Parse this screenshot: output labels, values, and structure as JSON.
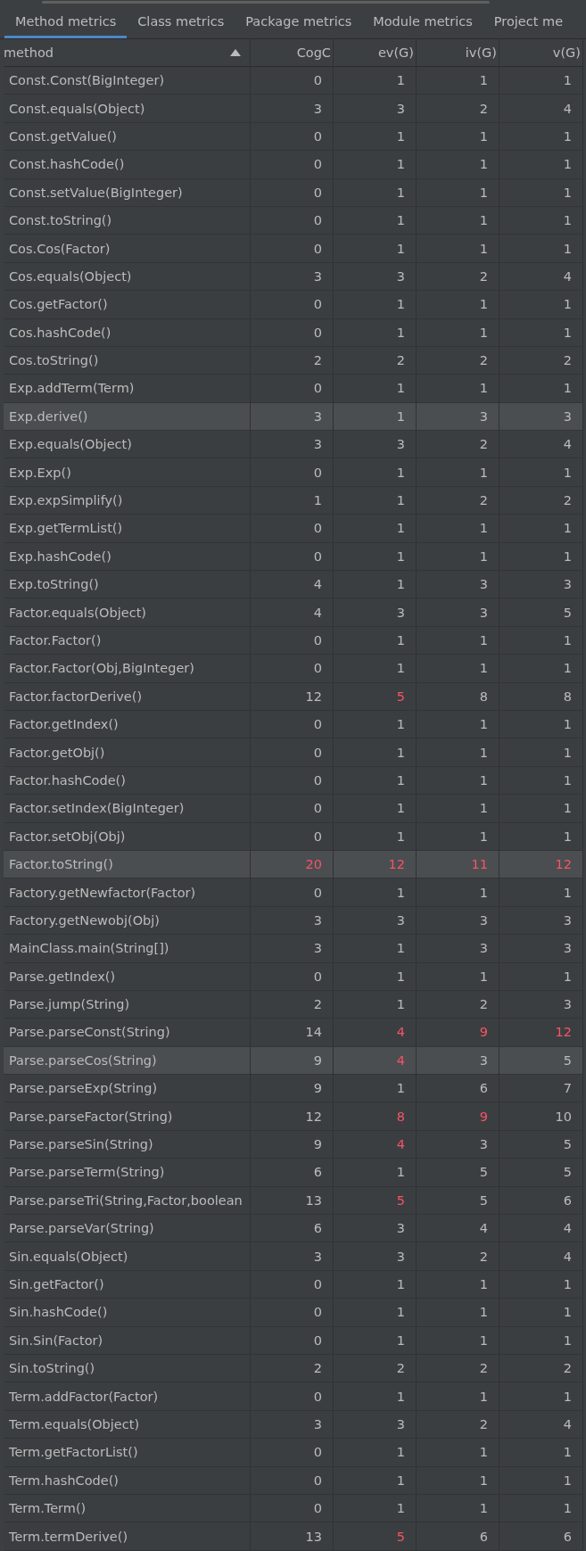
{
  "tabs": [
    {
      "label": "Method metrics",
      "selected": true
    },
    {
      "label": "Class metrics",
      "selected": false
    },
    {
      "label": "Package metrics",
      "selected": false
    },
    {
      "label": "Module metrics",
      "selected": false
    },
    {
      "label": "Project me",
      "selected": false
    }
  ],
  "table": {
    "columns": [
      {
        "label": "method",
        "sorted": true
      },
      {
        "label": "CogC",
        "sorted": false
      },
      {
        "label": "ev(G)",
        "sorted": false
      },
      {
        "label": "iv(G)",
        "sorted": false
      },
      {
        "label": "v(G)",
        "sorted": false
      }
    ],
    "rows": [
      {
        "selected": false,
        "cells": [
          {
            "value": "Const.Const(BigInteger)"
          },
          {
            "value": "0",
            "warning": false
          },
          {
            "value": "1",
            "warning": false
          },
          {
            "value": "1",
            "warning": false
          },
          {
            "value": "1",
            "warning": false
          }
        ]
      },
      {
        "selected": false,
        "cells": [
          {
            "value": "Const.equals(Object)"
          },
          {
            "value": "3",
            "warning": false
          },
          {
            "value": "3",
            "warning": false
          },
          {
            "value": "2",
            "warning": false
          },
          {
            "value": "4",
            "warning": false
          }
        ]
      },
      {
        "selected": false,
        "cells": [
          {
            "value": "Const.getValue()"
          },
          {
            "value": "0",
            "warning": false
          },
          {
            "value": "1",
            "warning": false
          },
          {
            "value": "1",
            "warning": false
          },
          {
            "value": "1",
            "warning": false
          }
        ]
      },
      {
        "selected": false,
        "cells": [
          {
            "value": "Const.hashCode()"
          },
          {
            "value": "0",
            "warning": false
          },
          {
            "value": "1",
            "warning": false
          },
          {
            "value": "1",
            "warning": false
          },
          {
            "value": "1",
            "warning": false
          }
        ]
      },
      {
        "selected": false,
        "cells": [
          {
            "value": "Const.setValue(BigInteger)"
          },
          {
            "value": "0",
            "warning": false
          },
          {
            "value": "1",
            "warning": false
          },
          {
            "value": "1",
            "warning": false
          },
          {
            "value": "1",
            "warning": false
          }
        ]
      },
      {
        "selected": false,
        "cells": [
          {
            "value": "Const.toString()"
          },
          {
            "value": "0",
            "warning": false
          },
          {
            "value": "1",
            "warning": false
          },
          {
            "value": "1",
            "warning": false
          },
          {
            "value": "1",
            "warning": false
          }
        ]
      },
      {
        "selected": false,
        "cells": [
          {
            "value": "Cos.Cos(Factor)"
          },
          {
            "value": "0",
            "warning": false
          },
          {
            "value": "1",
            "warning": false
          },
          {
            "value": "1",
            "warning": false
          },
          {
            "value": "1",
            "warning": false
          }
        ]
      },
      {
        "selected": false,
        "cells": [
          {
            "value": "Cos.equals(Object)"
          },
          {
            "value": "3",
            "warning": false
          },
          {
            "value": "3",
            "warning": false
          },
          {
            "value": "2",
            "warning": false
          },
          {
            "value": "4",
            "warning": false
          }
        ]
      },
      {
        "selected": false,
        "cells": [
          {
            "value": "Cos.getFactor()"
          },
          {
            "value": "0",
            "warning": false
          },
          {
            "value": "1",
            "warning": false
          },
          {
            "value": "1",
            "warning": false
          },
          {
            "value": "1",
            "warning": false
          }
        ]
      },
      {
        "selected": false,
        "cells": [
          {
            "value": "Cos.hashCode()"
          },
          {
            "value": "0",
            "warning": false
          },
          {
            "value": "1",
            "warning": false
          },
          {
            "value": "1",
            "warning": false
          },
          {
            "value": "1",
            "warning": false
          }
        ]
      },
      {
        "selected": false,
        "cells": [
          {
            "value": "Cos.toString()"
          },
          {
            "value": "2",
            "warning": false
          },
          {
            "value": "2",
            "warning": false
          },
          {
            "value": "2",
            "warning": false
          },
          {
            "value": "2",
            "warning": false
          }
        ]
      },
      {
        "selected": false,
        "cells": [
          {
            "value": "Exp.addTerm(Term)"
          },
          {
            "value": "0",
            "warning": false
          },
          {
            "value": "1",
            "warning": false
          },
          {
            "value": "1",
            "warning": false
          },
          {
            "value": "1",
            "warning": false
          }
        ]
      },
      {
        "selected": true,
        "cells": [
          {
            "value": "Exp.derive()"
          },
          {
            "value": "3",
            "warning": false
          },
          {
            "value": "1",
            "warning": false
          },
          {
            "value": "3",
            "warning": false
          },
          {
            "value": "3",
            "warning": false
          }
        ]
      },
      {
        "selected": false,
        "cells": [
          {
            "value": "Exp.equals(Object)"
          },
          {
            "value": "3",
            "warning": false
          },
          {
            "value": "3",
            "warning": false
          },
          {
            "value": "2",
            "warning": false
          },
          {
            "value": "4",
            "warning": false
          }
        ]
      },
      {
        "selected": false,
        "cells": [
          {
            "value": "Exp.Exp()"
          },
          {
            "value": "0",
            "warning": false
          },
          {
            "value": "1",
            "warning": false
          },
          {
            "value": "1",
            "warning": false
          },
          {
            "value": "1",
            "warning": false
          }
        ]
      },
      {
        "selected": false,
        "cells": [
          {
            "value": "Exp.expSimplify()"
          },
          {
            "value": "1",
            "warning": false
          },
          {
            "value": "1",
            "warning": false
          },
          {
            "value": "2",
            "warning": false
          },
          {
            "value": "2",
            "warning": false
          }
        ]
      },
      {
        "selected": false,
        "cells": [
          {
            "value": "Exp.getTermList()"
          },
          {
            "value": "0",
            "warning": false
          },
          {
            "value": "1",
            "warning": false
          },
          {
            "value": "1",
            "warning": false
          },
          {
            "value": "1",
            "warning": false
          }
        ]
      },
      {
        "selected": false,
        "cells": [
          {
            "value": "Exp.hashCode()"
          },
          {
            "value": "0",
            "warning": false
          },
          {
            "value": "1",
            "warning": false
          },
          {
            "value": "1",
            "warning": false
          },
          {
            "value": "1",
            "warning": false
          }
        ]
      },
      {
        "selected": false,
        "cells": [
          {
            "value": "Exp.toString()"
          },
          {
            "value": "4",
            "warning": false
          },
          {
            "value": "1",
            "warning": false
          },
          {
            "value": "3",
            "warning": false
          },
          {
            "value": "3",
            "warning": false
          }
        ]
      },
      {
        "selected": false,
        "cells": [
          {
            "value": "Factor.equals(Object)"
          },
          {
            "value": "4",
            "warning": false
          },
          {
            "value": "3",
            "warning": false
          },
          {
            "value": "3",
            "warning": false
          },
          {
            "value": "5",
            "warning": false
          }
        ]
      },
      {
        "selected": false,
        "cells": [
          {
            "value": "Factor.Factor()"
          },
          {
            "value": "0",
            "warning": false
          },
          {
            "value": "1",
            "warning": false
          },
          {
            "value": "1",
            "warning": false
          },
          {
            "value": "1",
            "warning": false
          }
        ]
      },
      {
        "selected": false,
        "cells": [
          {
            "value": "Factor.Factor(Obj,BigInteger)"
          },
          {
            "value": "0",
            "warning": false
          },
          {
            "value": "1",
            "warning": false
          },
          {
            "value": "1",
            "warning": false
          },
          {
            "value": "1",
            "warning": false
          }
        ]
      },
      {
        "selected": false,
        "cells": [
          {
            "value": "Factor.factorDerive()"
          },
          {
            "value": "12",
            "warning": false
          },
          {
            "value": "5",
            "warning": true
          },
          {
            "value": "8",
            "warning": false
          },
          {
            "value": "8",
            "warning": false
          }
        ]
      },
      {
        "selected": false,
        "cells": [
          {
            "value": "Factor.getIndex()"
          },
          {
            "value": "0",
            "warning": false
          },
          {
            "value": "1",
            "warning": false
          },
          {
            "value": "1",
            "warning": false
          },
          {
            "value": "1",
            "warning": false
          }
        ]
      },
      {
        "selected": false,
        "cells": [
          {
            "value": "Factor.getObj()"
          },
          {
            "value": "0",
            "warning": false
          },
          {
            "value": "1",
            "warning": false
          },
          {
            "value": "1",
            "warning": false
          },
          {
            "value": "1",
            "warning": false
          }
        ]
      },
      {
        "selected": false,
        "cells": [
          {
            "value": "Factor.hashCode()"
          },
          {
            "value": "0",
            "warning": false
          },
          {
            "value": "1",
            "warning": false
          },
          {
            "value": "1",
            "warning": false
          },
          {
            "value": "1",
            "warning": false
          }
        ]
      },
      {
        "selected": false,
        "cells": [
          {
            "value": "Factor.setIndex(BigInteger)"
          },
          {
            "value": "0",
            "warning": false
          },
          {
            "value": "1",
            "warning": false
          },
          {
            "value": "1",
            "warning": false
          },
          {
            "value": "1",
            "warning": false
          }
        ]
      },
      {
        "selected": false,
        "cells": [
          {
            "value": "Factor.setObj(Obj)"
          },
          {
            "value": "0",
            "warning": false
          },
          {
            "value": "1",
            "warning": false
          },
          {
            "value": "1",
            "warning": false
          },
          {
            "value": "1",
            "warning": false
          }
        ]
      },
      {
        "selected": true,
        "cells": [
          {
            "value": "Factor.toString()"
          },
          {
            "value": "20",
            "warning": true
          },
          {
            "value": "12",
            "warning": true
          },
          {
            "value": "11",
            "warning": true
          },
          {
            "value": "12",
            "warning": true
          }
        ]
      },
      {
        "selected": false,
        "cells": [
          {
            "value": "Factory.getNewfactor(Factor)"
          },
          {
            "value": "0",
            "warning": false
          },
          {
            "value": "1",
            "warning": false
          },
          {
            "value": "1",
            "warning": false
          },
          {
            "value": "1",
            "warning": false
          }
        ]
      },
      {
        "selected": false,
        "cells": [
          {
            "value": "Factory.getNewobj(Obj)"
          },
          {
            "value": "3",
            "warning": false
          },
          {
            "value": "3",
            "warning": false
          },
          {
            "value": "3",
            "warning": false
          },
          {
            "value": "3",
            "warning": false
          }
        ]
      },
      {
        "selected": false,
        "cells": [
          {
            "value": "MainClass.main(String[])"
          },
          {
            "value": "3",
            "warning": false
          },
          {
            "value": "1",
            "warning": false
          },
          {
            "value": "3",
            "warning": false
          },
          {
            "value": "3",
            "warning": false
          }
        ]
      },
      {
        "selected": false,
        "cells": [
          {
            "value": "Parse.getIndex()"
          },
          {
            "value": "0",
            "warning": false
          },
          {
            "value": "1",
            "warning": false
          },
          {
            "value": "1",
            "warning": false
          },
          {
            "value": "1",
            "warning": false
          }
        ]
      },
      {
        "selected": false,
        "cells": [
          {
            "value": "Parse.jump(String)"
          },
          {
            "value": "2",
            "warning": false
          },
          {
            "value": "1",
            "warning": false
          },
          {
            "value": "2",
            "warning": false
          },
          {
            "value": "3",
            "warning": false
          }
        ]
      },
      {
        "selected": false,
        "cells": [
          {
            "value": "Parse.parseConst(String)"
          },
          {
            "value": "14",
            "warning": false
          },
          {
            "value": "4",
            "warning": true
          },
          {
            "value": "9",
            "warning": true
          },
          {
            "value": "12",
            "warning": true
          }
        ]
      },
      {
        "selected": true,
        "cells": [
          {
            "value": "Parse.parseCos(String)"
          },
          {
            "value": "9",
            "warning": false
          },
          {
            "value": "4",
            "warning": true
          },
          {
            "value": "3",
            "warning": false
          },
          {
            "value": "5",
            "warning": false
          }
        ]
      },
      {
        "selected": false,
        "cells": [
          {
            "value": "Parse.parseExp(String)"
          },
          {
            "value": "9",
            "warning": false
          },
          {
            "value": "1",
            "warning": false
          },
          {
            "value": "6",
            "warning": false
          },
          {
            "value": "7",
            "warning": false
          }
        ]
      },
      {
        "selected": false,
        "cells": [
          {
            "value": "Parse.parseFactor(String)"
          },
          {
            "value": "12",
            "warning": false
          },
          {
            "value": "8",
            "warning": true
          },
          {
            "value": "9",
            "warning": true
          },
          {
            "value": "10",
            "warning": false
          }
        ]
      },
      {
        "selected": false,
        "cells": [
          {
            "value": "Parse.parseSin(String)"
          },
          {
            "value": "9",
            "warning": false
          },
          {
            "value": "4",
            "warning": true
          },
          {
            "value": "3",
            "warning": false
          },
          {
            "value": "5",
            "warning": false
          }
        ]
      },
      {
        "selected": false,
        "cells": [
          {
            "value": "Parse.parseTerm(String)"
          },
          {
            "value": "6",
            "warning": false
          },
          {
            "value": "1",
            "warning": false
          },
          {
            "value": "5",
            "warning": false
          },
          {
            "value": "5",
            "warning": false
          }
        ]
      },
      {
        "selected": false,
        "cells": [
          {
            "value": "Parse.parseTri(String,Factor,boolean"
          },
          {
            "value": "13",
            "warning": false
          },
          {
            "value": "5",
            "warning": true
          },
          {
            "value": "5",
            "warning": false
          },
          {
            "value": "6",
            "warning": false
          }
        ]
      },
      {
        "selected": false,
        "cells": [
          {
            "value": "Parse.parseVar(String)"
          },
          {
            "value": "6",
            "warning": false
          },
          {
            "value": "3",
            "warning": false
          },
          {
            "value": "4",
            "warning": false
          },
          {
            "value": "4",
            "warning": false
          }
        ]
      },
      {
        "selected": false,
        "cells": [
          {
            "value": "Sin.equals(Object)"
          },
          {
            "value": "3",
            "warning": false
          },
          {
            "value": "3",
            "warning": false
          },
          {
            "value": "2",
            "warning": false
          },
          {
            "value": "4",
            "warning": false
          }
        ]
      },
      {
        "selected": false,
        "cells": [
          {
            "value": "Sin.getFactor()"
          },
          {
            "value": "0",
            "warning": false
          },
          {
            "value": "1",
            "warning": false
          },
          {
            "value": "1",
            "warning": false
          },
          {
            "value": "1",
            "warning": false
          }
        ]
      },
      {
        "selected": false,
        "cells": [
          {
            "value": "Sin.hashCode()"
          },
          {
            "value": "0",
            "warning": false
          },
          {
            "value": "1",
            "warning": false
          },
          {
            "value": "1",
            "warning": false
          },
          {
            "value": "1",
            "warning": false
          }
        ]
      },
      {
        "selected": false,
        "cells": [
          {
            "value": "Sin.Sin(Factor)"
          },
          {
            "value": "0",
            "warning": false
          },
          {
            "value": "1",
            "warning": false
          },
          {
            "value": "1",
            "warning": false
          },
          {
            "value": "1",
            "warning": false
          }
        ]
      },
      {
        "selected": false,
        "cells": [
          {
            "value": "Sin.toString()"
          },
          {
            "value": "2",
            "warning": false
          },
          {
            "value": "2",
            "warning": false
          },
          {
            "value": "2",
            "warning": false
          },
          {
            "value": "2",
            "warning": false
          }
        ]
      },
      {
        "selected": false,
        "cells": [
          {
            "value": "Term.addFactor(Factor)"
          },
          {
            "value": "0",
            "warning": false
          },
          {
            "value": "1",
            "warning": false
          },
          {
            "value": "1",
            "warning": false
          },
          {
            "value": "1",
            "warning": false
          }
        ]
      },
      {
        "selected": false,
        "cells": [
          {
            "value": "Term.equals(Object)"
          },
          {
            "value": "3",
            "warning": false
          },
          {
            "value": "3",
            "warning": false
          },
          {
            "value": "2",
            "warning": false
          },
          {
            "value": "4",
            "warning": false
          }
        ]
      },
      {
        "selected": false,
        "cells": [
          {
            "value": "Term.getFactorList()"
          },
          {
            "value": "0",
            "warning": false
          },
          {
            "value": "1",
            "warning": false
          },
          {
            "value": "1",
            "warning": false
          },
          {
            "value": "1",
            "warning": false
          }
        ]
      },
      {
        "selected": false,
        "cells": [
          {
            "value": "Term.hashCode()"
          },
          {
            "value": "0",
            "warning": false
          },
          {
            "value": "1",
            "warning": false
          },
          {
            "value": "1",
            "warning": false
          },
          {
            "value": "1",
            "warning": false
          }
        ]
      },
      {
        "selected": false,
        "cells": [
          {
            "value": "Term.Term()"
          },
          {
            "value": "0",
            "warning": false
          },
          {
            "value": "1",
            "warning": false
          },
          {
            "value": "1",
            "warning": false
          },
          {
            "value": "1",
            "warning": false
          }
        ]
      },
      {
        "selected": false,
        "cells": [
          {
            "value": "Term.termDerive()"
          },
          {
            "value": "13",
            "warning": false
          },
          {
            "value": "5",
            "warning": true
          },
          {
            "value": "6",
            "warning": false
          },
          {
            "value": "6",
            "warning": false
          }
        ]
      }
    ]
  }
}
